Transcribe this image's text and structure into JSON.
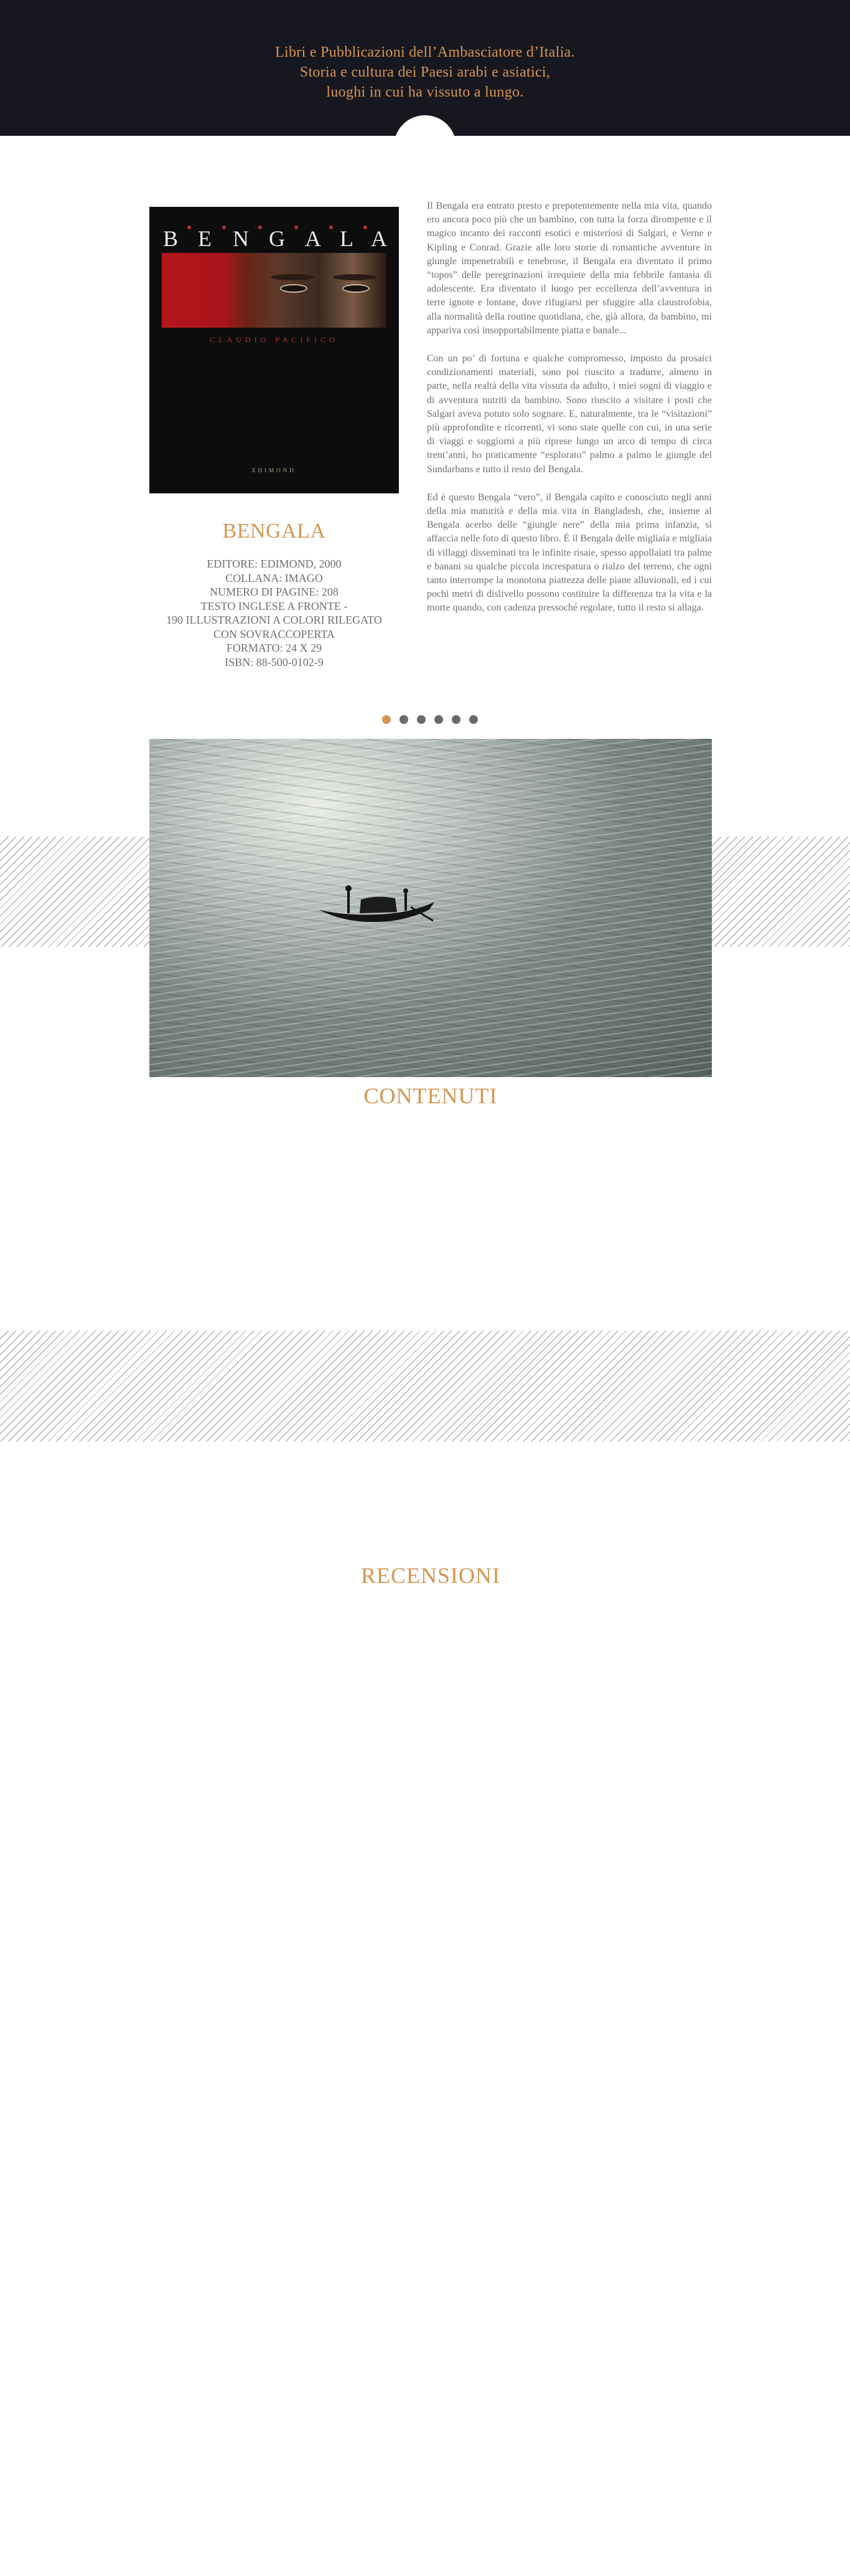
{
  "header": {
    "tagline": [
      "Libri e Pubblicazioni  dell’Ambasciatore d’Italia.",
      "Storia e cultura dei Paesi arabi e asiatici,",
      "luoghi in cui ha vissuto a lungo."
    ]
  },
  "book": {
    "cover": {
      "title_letters": [
        "B",
        "E",
        "N",
        "G",
        "A",
        "L",
        "A"
      ],
      "author": "CLAUDIO PACIFICO",
      "publisher": "EDIMOND"
    },
    "title": "BENGALA",
    "meta": [
      "EDITORE: EDIMOND, 2000",
      "COLLANA: IMAGO",
      "NUMERO DI PAGINE: 208",
      "TESTO INGLESE A FRONTE -",
      "190 ILLUSTRAZIONI A COLORI RILEGATO",
      "CON SOVRACCOPERTA",
      "FORMATO: 24 X 29",
      "ISBN: 88-500-0102-9"
    ],
    "paragraphs": [
      "Il Bengala era entrato presto e prepotentemente nella mia vita, quando ero ancora poco più che un bambino, con tutta la forza dirompente e il magico incanto dei racconti esotici e misteriosi di Salgari, e Verne e Kipling e Conrad. Grazie alle loro storie di romantiche avventure in giungle impenetrabili e tenebrose, il Bengala era diventato il primo “topos” delle peregrinazioni irrequiete della mia febbrile fantasia di adolescente. Era diventato il luogo per eccellenza dell’avventura in terre ignote e lontane, dove rifugiarsi per sfuggire alla claustrofobia, alla normalità della routine quotidiana, che, già allora, da bambino, mi appariva così insopportabilmente piatta e banale...",
      "Con un po’ di fortuna e qualche compromesso, imposto da prosaici condizionamenti materiali, sono poi riuscito a tradurre, almeno in parte, nella realtà della vita vissuta da adulto, i miei sogni di viaggio e di avventura nutriti da bambino. Sono riuscito a visitare i posti che Salgari aveva potuto solo sognare. E, naturalmente, tra le “visitazioni” più approfondite e ricorrenti, vi sono state quelle con cui, in una serie di viaggi e soggiorni a più riprese lungo un arco di tempo di circa trent’anni, ho praticamente “esplorato” palmo a palmo le giungle del Sundarbans e tutto il resto del Bengala.",
      "Ed è questo Bengala “vero”, il Bengala capito e conosciuto negli anni della mia maturità e della mia vita in Bangladesh, che, insieme al Bengala acerbo delle “giungle nere” della mia prima infanzia, si affaccia nelle foto di questo libro. È il Bengala delle migliaia e migliaia di villaggi disseminati tra le infinite risaie, spesso appollaiati tra palme e banani su qualche piccola increspatura o rialzo del terreno, che ogni tanto interrompe la monotona piattezza delle piane alluvionali, ed i cui pochi metri di dislivello possono costituire la differenza tra la vita e la morte quando, con cadenza pressoché regolare, tutto il resto si allaga."
    ]
  },
  "carousel": {
    "slide_count": 6,
    "active_index": 0
  },
  "sections": {
    "contenuti": "CONTENUTI",
    "recensioni": "RECENSIONI"
  },
  "colors": {
    "accent": "#d5954f",
    "header_bg": "#171720",
    "text": "#6e6e6e"
  }
}
